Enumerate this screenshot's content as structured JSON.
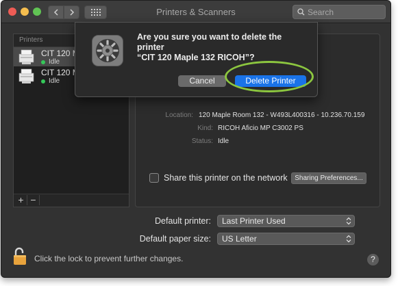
{
  "window": {
    "title": "Printers & Scanners"
  },
  "search": {
    "placeholder": "Search"
  },
  "printers_pane": {
    "header": "Printers",
    "items": [
      {
        "name": "CIT 120 M",
        "status": "Idle"
      },
      {
        "name": "CIT 120 M",
        "status": "Idle"
      }
    ],
    "add_label": "+",
    "remove_label": "−"
  },
  "details": {
    "location_label": "Location:",
    "location_value": "120 Maple Room 132 - W493L400316 - 10.236.70.159",
    "kind_label": "Kind:",
    "kind_value": "RICOH Aficio MP C3002 PS",
    "status_label": "Status:",
    "status_value": "Idle",
    "share_label": "Share this printer on the network",
    "sharing_button": "Sharing Preferences..."
  },
  "defaults": {
    "printer_label": "Default printer:",
    "printer_value": "Last Printer Used",
    "paper_label": "Default paper size:",
    "paper_value": "US Letter"
  },
  "footer": {
    "lock_text": "Click the lock to prevent further changes.",
    "help": "?"
  },
  "dialog": {
    "message_line1": "Are you sure you want to delete the printer",
    "message_line2": "“CIT 120 Maple 132 RICOH”?",
    "cancel_label": "Cancel",
    "delete_label": "Delete Printer"
  },
  "colors": {
    "accent_blue": "#1a73e8",
    "highlight_green": "#8cc63f",
    "status_green": "#35c759",
    "lock_orange": "#e8a33c"
  }
}
